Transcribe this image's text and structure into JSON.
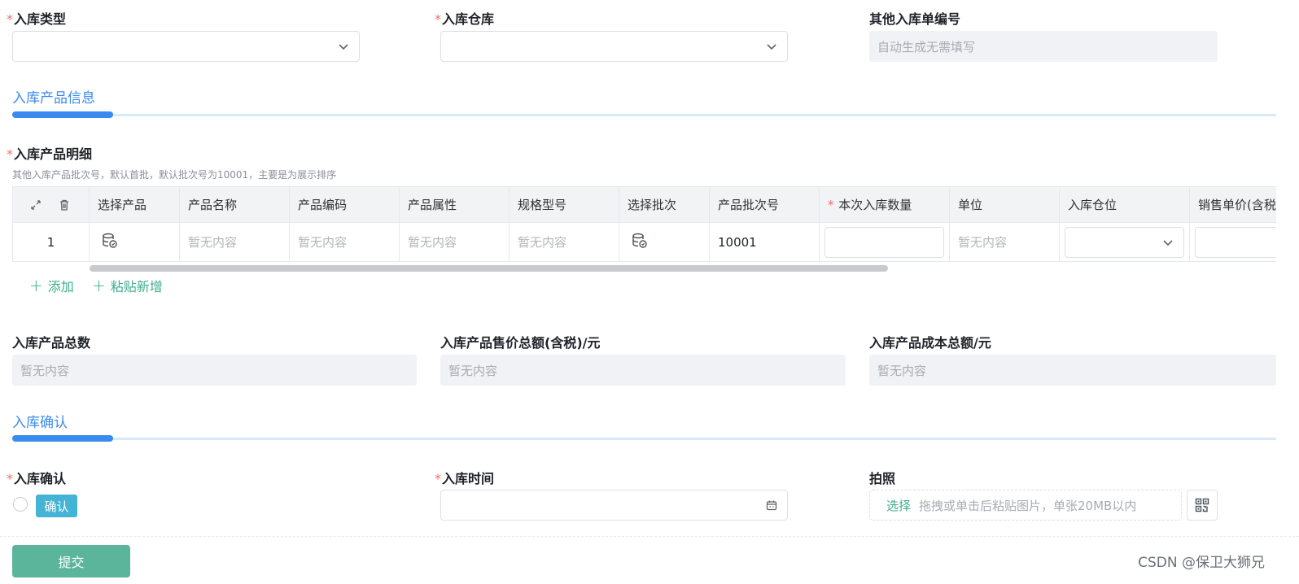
{
  "form": {
    "inbound_type": {
      "required_mark": "*",
      "label": "入库类型",
      "value": ""
    },
    "warehouse": {
      "required_mark": "*",
      "label": "入库仓库",
      "value": ""
    },
    "other_order_no": {
      "label": "其他入库单编号",
      "placeholder": "自动生成无需填写"
    }
  },
  "section_product": {
    "title": "入库产品信息"
  },
  "detail": {
    "required_mark": "*",
    "label": "入库产品明细",
    "hint": "其他入库产品批次号，默认首批，默认批次号为10001，主要是为展示排序",
    "columns": [
      "选择产品",
      "产品名称",
      "产品编码",
      "产品属性",
      "规格型号",
      "选择批次",
      "产品批次号",
      "本次入库数量",
      "单位",
      "入库仓位",
      "销售单价(含税"
    ],
    "quantity_required_mark": "*",
    "rows": [
      {
        "index": "1",
        "name": "暂无内容",
        "code": "暂无内容",
        "attr": "暂无内容",
        "spec": "暂无内容",
        "batch_no": "10001",
        "unit": "暂无内容"
      }
    ],
    "add_label": "添加",
    "paste_label": "粘贴新增"
  },
  "totals": {
    "count": {
      "label": "入库产品总数",
      "value": "暂无内容"
    },
    "sale_amount": {
      "label": "入库产品售价总额(含税)/元",
      "value": "暂无内容"
    },
    "cost_amount": {
      "label": "入库产品成本总额/元",
      "value": "暂无内容"
    }
  },
  "section_confirm": {
    "title": "入库确认"
  },
  "confirm": {
    "required_mark": "*",
    "label": "入库确认",
    "tag": "确认",
    "time": {
      "required_mark": "*",
      "label": "入库时间",
      "value": ""
    },
    "photo": {
      "label": "拍照",
      "select_label": "选择",
      "upload_hint": "拖拽或单击后粘贴图片，单张20MB以内"
    }
  },
  "submit_label": "提交",
  "watermark": "CSDN @保卫大狮兄",
  "colors": {
    "accent": "#3a8bef",
    "green": "#3fae8c",
    "submit": "#5bb59a",
    "required": "#f56c6c",
    "tag": "#45b3d6"
  }
}
